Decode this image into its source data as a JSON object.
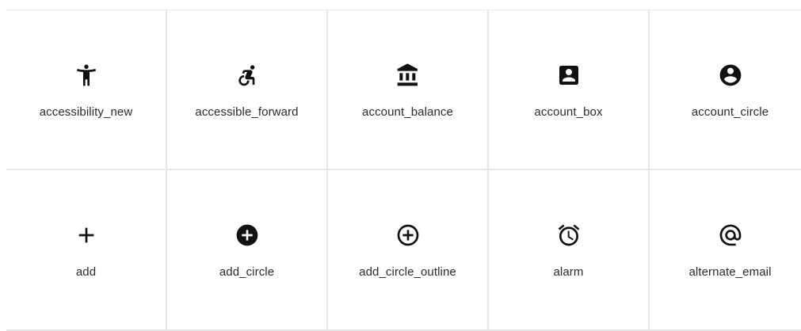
{
  "icons": [
    {
      "name": "accessibility_new",
      "icon": "accessibility-new-icon"
    },
    {
      "name": "accessible_forward",
      "icon": "accessible-forward-icon"
    },
    {
      "name": "account_balance",
      "icon": "account-balance-icon"
    },
    {
      "name": "account_box",
      "icon": "account-box-icon"
    },
    {
      "name": "account_circle",
      "icon": "account-circle-icon"
    },
    {
      "name": "add",
      "icon": "add-icon"
    },
    {
      "name": "add_circle",
      "icon": "add-circle-icon"
    },
    {
      "name": "add_circle_outline",
      "icon": "add-circle-outline-icon"
    },
    {
      "name": "alarm",
      "icon": "alarm-icon"
    },
    {
      "name": "alternate_email",
      "icon": "alternate-email-icon"
    }
  ],
  "colors": {
    "icon": "#111111",
    "text": "#2b2b2b",
    "border": "#e6e6e6"
  }
}
